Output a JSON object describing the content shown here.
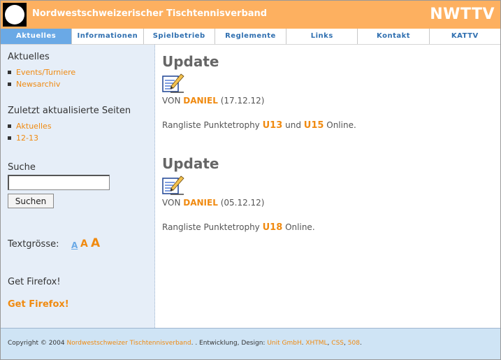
{
  "header": {
    "title": "Nordwestschweizerischer Tischtennisverband",
    "abbr": "NWTTV"
  },
  "nav": {
    "items": [
      {
        "label": "Aktuelles",
        "active": true
      },
      {
        "label": "Informationen"
      },
      {
        "label": "Spielbetrieb"
      },
      {
        "label": "Reglemente"
      },
      {
        "label": "Links"
      },
      {
        "label": "Kontakt"
      },
      {
        "label": "KATTV"
      }
    ]
  },
  "sidebar": {
    "section1": {
      "heading": "Aktuelles",
      "links": [
        "Events/Turniere",
        "Newsarchiv"
      ]
    },
    "section2": {
      "heading": "Zuletzt aktualisierte Seiten",
      "links": [
        "Aktuelles",
        "12-13"
      ]
    },
    "search": {
      "heading": "Suche",
      "input_value": "",
      "button_label": "Suchen"
    },
    "textsize": {
      "label": "Textgrösse:",
      "small": "A",
      "medium": "A",
      "large": "A"
    },
    "firefox": {
      "heading": "Get Firefox!",
      "link": "Get Firefox!"
    }
  },
  "posts": [
    {
      "title": "Update",
      "icon": "edit-document-icon",
      "by": "VON",
      "author": "DANIEL",
      "date": "(17.12.12)",
      "body_prefix": "Rangliste Punktetrophy",
      "link1": "U13",
      "joiner": "und",
      "link2": "U15",
      "body_suffix": "Online."
    },
    {
      "title": "Update",
      "icon": "edit-document-icon",
      "by": "VON",
      "author": "DANIEL",
      "date": "(05.12.12)",
      "body_prefix": "Rangliste Punktetrophy",
      "link1": "U18",
      "body_suffix": "Online."
    }
  ],
  "footer": {
    "copyright": "Copyright © 2004",
    "org_link": "Nordwestschweizer Tischtennisverband",
    "middle": ". . Entwicklung, Design:",
    "unit_link": "Unit GmbH",
    "dot": ".",
    "xhtml_link": "XHTML",
    "comma1": ",",
    "css_link": "CSS",
    "comma2": ",",
    "num_link": "508",
    "end": "."
  },
  "colors": {
    "header_bg": "#fdb060",
    "nav_active_bg": "#6aa9e6",
    "link": "#f08a10",
    "sidebar_bg": "#e6eef8",
    "footer_bg": "#cfe4f5"
  }
}
